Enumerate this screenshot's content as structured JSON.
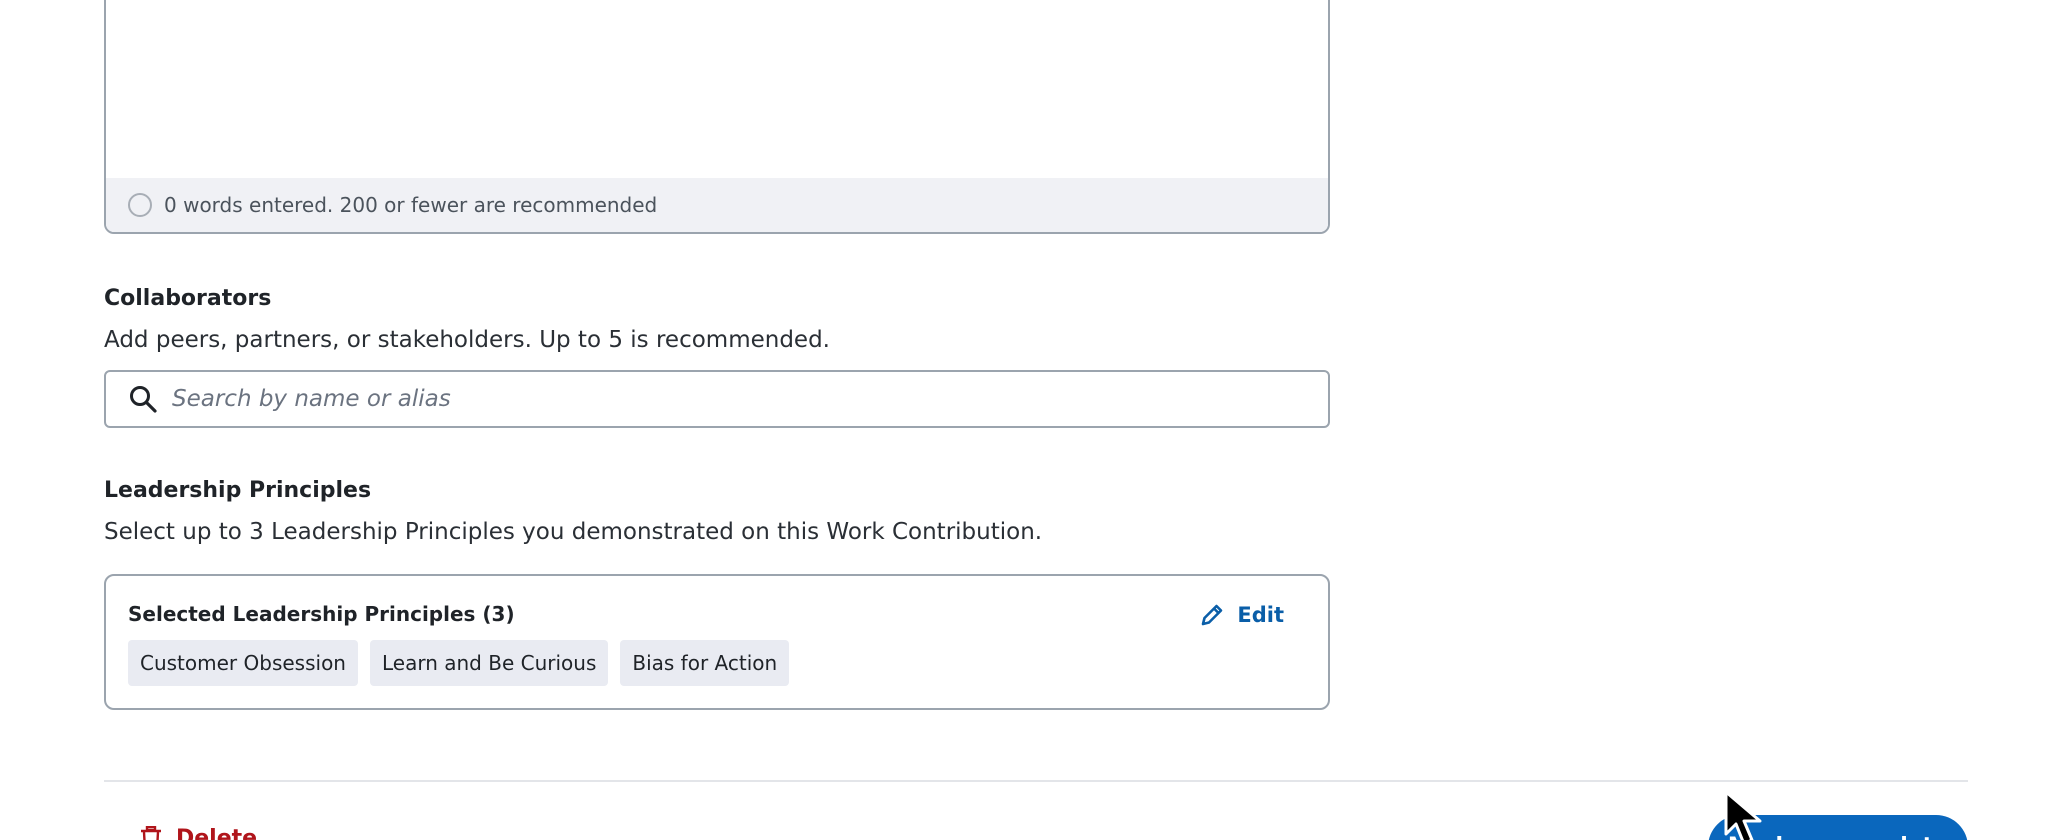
{
  "description_field": {
    "word_count_text": "0 words entered. 200 or fewer are recommended"
  },
  "collaborators": {
    "title": "Collaborators",
    "description": "Add peers, partners, or stakeholders. Up to 5 is recommended.",
    "search_placeholder": "Search by name or alias"
  },
  "leadership_principles": {
    "title": "Leadership Principles",
    "description": "Select up to 3 Leadership Principles you demonstrated on this Work Contribution.",
    "card_title": "Selected Leadership Principles (3)",
    "edit_label": "Edit",
    "selected": [
      "Customer Obsession",
      "Learn and Be Curious",
      "Bias for Action"
    ]
  },
  "footer": {
    "delete_label": "Delete",
    "primary_label": "Mark as complete"
  },
  "colors": {
    "accent": "#0a67bd",
    "link": "#0a5ea8",
    "danger": "#b0151b",
    "tag_bg": "#e9ebf2"
  }
}
